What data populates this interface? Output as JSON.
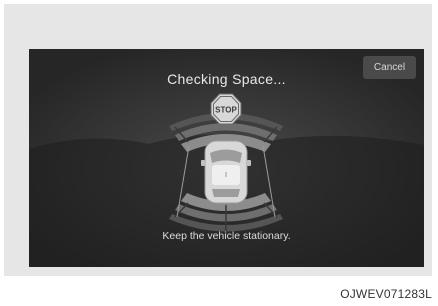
{
  "screen": {
    "title": "Checking Space...",
    "cancel_label": "Cancel",
    "message": "Keep the vehicle stationary.",
    "stop_sign_text": "STOP"
  },
  "image_code": "OJWEV071283L",
  "icons": [
    "stop-sign-icon",
    "car-top-view-icon",
    "sensor-zone-icon"
  ],
  "colors": {
    "screen_bg": "#2e2e2e",
    "button_bg": "#4a4a4a",
    "text": "#e8e8e8"
  }
}
